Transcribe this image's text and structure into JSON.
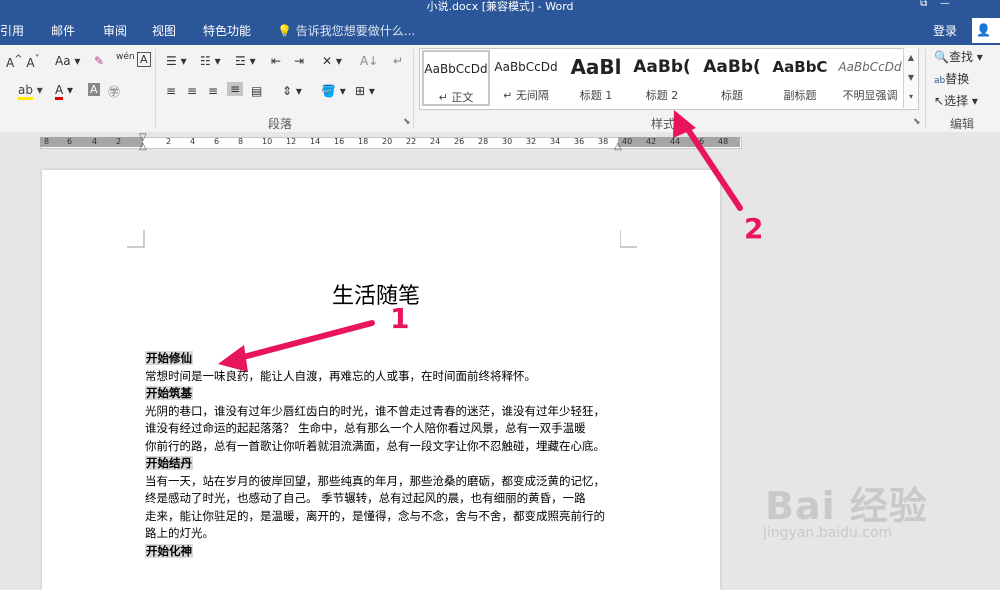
{
  "window": {
    "title": "小说.docx [兼容模式] - Word"
  },
  "tabs": [
    "引用",
    "邮件",
    "审阅",
    "视图",
    "特色功能"
  ],
  "tell_me": "告诉我您想要做什么...",
  "account": {
    "login": "登录",
    "share": "共"
  },
  "ribbon": {
    "font_group": {
      "aa": "Aa",
      "wen": "wén",
      "a_box": "A"
    },
    "paragraph_label": "段落",
    "styles_label": "样式",
    "editing_label": "编辑",
    "styles": [
      {
        "preview": "AaBbCcDd",
        "name": "正文",
        "prefix": "↵"
      },
      {
        "preview": "AaBbCcDd",
        "name": "无间隔",
        "prefix": "↵"
      },
      {
        "preview": "AaBl",
        "name": "标题 1"
      },
      {
        "preview": "AaBb(",
        "name": "标题 2"
      },
      {
        "preview": "AaBb(",
        "name": "标题"
      },
      {
        "preview": "AaBbC",
        "name": "副标题"
      },
      {
        "preview": "AaBbCcDd",
        "name": "不明显强调"
      }
    ],
    "editing": {
      "find": "查找",
      "replace": "替换",
      "select": "选择"
    }
  },
  "ruler_numbers": [
    "8",
    "6",
    "4",
    "2",
    "2",
    "4",
    "6",
    "8",
    "10",
    "12",
    "14",
    "16",
    "18",
    "20",
    "22",
    "24",
    "26",
    "28",
    "30",
    "32",
    "34",
    "36",
    "38",
    "40",
    "42",
    "44",
    "46",
    "48"
  ],
  "document": {
    "title": "生活随笔",
    "lines": [
      {
        "type": "heading",
        "text": "开始修仙"
      },
      {
        "type": "text",
        "text": "常想时间是一味良药，能让人自渡，再难忘的人或事，在时间面前终将释怀。"
      },
      {
        "type": "heading",
        "text": "开始筑基"
      },
      {
        "type": "text",
        "text": "光阴的巷口，谁没有过年少唇红齿白的时光，谁不曾走过青春的迷茫，谁没有过年少轻狂，"
      },
      {
        "type": "text",
        "text": "谁没有经过命运的起起落落？      生命中，总有那么一个人陪你看过风景，总有一双手温暖"
      },
      {
        "type": "text",
        "text": "你前行的路，总有一首歌让你听着就泪流满面，总有一段文字让你不忍触碰，埋藏在心底。"
      },
      {
        "type": "heading",
        "text": "开始结丹"
      },
      {
        "type": "text",
        "text": "当有一天，站在岁月的彼岸回望，那些纯真的年月，那些沧桑的磨砺，都变成泛黄的记忆，"
      },
      {
        "type": "text",
        "text": "终是感动了时光，也感动了自己。      季节辗转，总有过起风的晨，也有细丽的黄昏，一路"
      },
      {
        "type": "text",
        "text": "走来，能让你驻足的，是温暖，离开的，是懂得，念与不念，舍与不舍，都变成照亮前行的"
      },
      {
        "type": "text",
        "text": "路上的灯光。"
      },
      {
        "type": "heading",
        "text": "开始化神"
      }
    ]
  },
  "annotations": [
    "1",
    "2"
  ],
  "watermark": {
    "brand": "Bai 经验",
    "url": "jingyan.baidu.com"
  },
  "colors": {
    "brand": "#2b579a",
    "annotation": "#e8145d"
  }
}
